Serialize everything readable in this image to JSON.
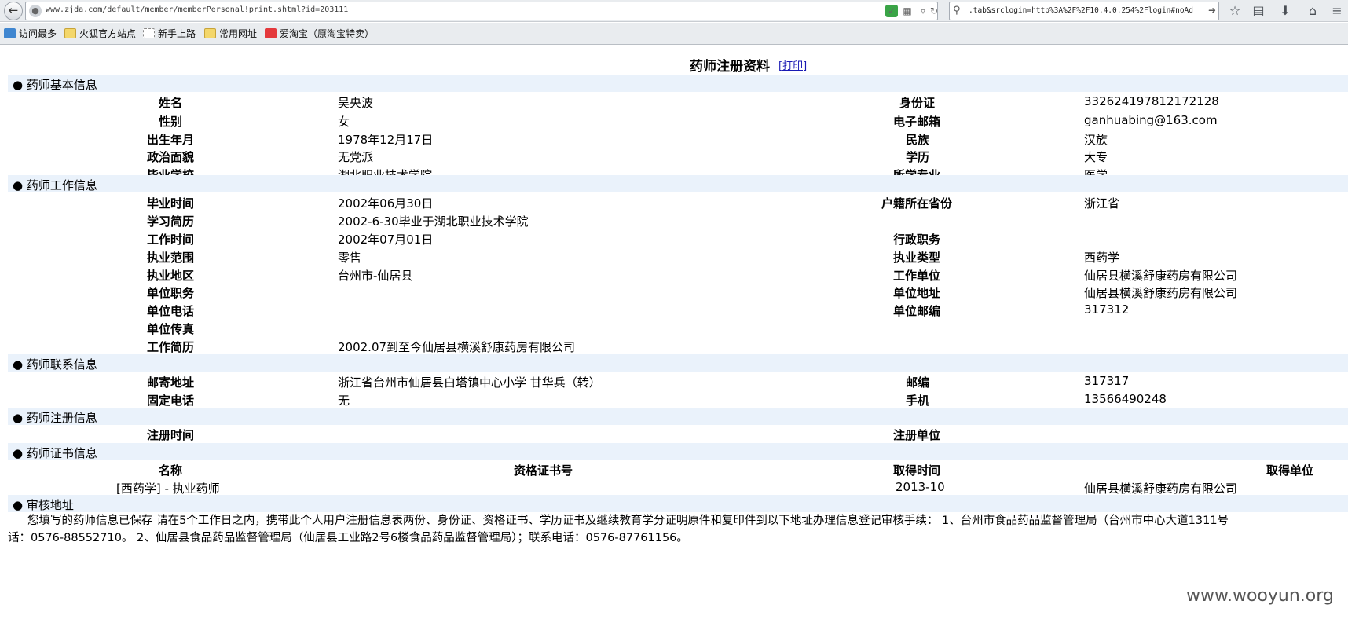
{
  "browser": {
    "url": "www.zjda.com/default/member/memberPersonal!print.shtml?id=203111",
    "search": ".tab&srclogin=http%3A%2F%2F10.4.0.254%2Flogin#noAd",
    "bookmarks": [
      "访问最多",
      "火狐官方站点",
      "新手上路",
      "常用网址",
      "爱淘宝（原淘宝特卖）"
    ]
  },
  "page": {
    "title": "药师注册资料",
    "print": "[打印]"
  },
  "sections": {
    "basic": "● 药师基本信息",
    "work": "● 药师工作信息",
    "contact": "● 药师联系信息",
    "register": "● 药师注册信息",
    "cert": "● 药师证书信息",
    "audit": "● 审核地址"
  },
  "basic": {
    "name_label": "姓名",
    "name": "吴央波",
    "id_label": "身份证",
    "id": "332624197812172128",
    "gender_label": "性别",
    "gender": "女",
    "email_label": "电子邮箱",
    "email": "ganhuabing@163.com",
    "birth_label": "出生年月",
    "birth": "1978年12月17日",
    "ethnic_label": "民族",
    "ethnic": "汉族",
    "politics_label": "政治面貌",
    "politics": "无党派",
    "edu_label": "学历",
    "edu": "大专",
    "school_label": "毕业学校",
    "school": "湖北职业技术学院",
    "major_label": "所学专业",
    "major": "医学"
  },
  "work": {
    "grad_label": "毕业时间",
    "grad": "2002年06月30日",
    "province_label": "户籍所在省份",
    "province": "浙江省",
    "study_label": "学习简历",
    "study": "2002-6-30毕业于湖北职业技术学院",
    "start_label": "工作时间",
    "start": "2002年07月01日",
    "admin_label": "行政职务",
    "admin": "",
    "scope_label": "执业范围",
    "scope": "零售",
    "type_label": "执业类型",
    "type": "西药学",
    "area_label": "执业地区",
    "area": "台州市-仙居县",
    "unit_label": "工作单位",
    "unit": "仙居县横溪舒康药房有限公司",
    "duty_label": "单位职务",
    "duty": "",
    "addr_label": "单位地址",
    "addr": "仙居县横溪舒康药房有限公司",
    "tel_label": "单位电话",
    "tel": "",
    "zip_label": "单位邮编",
    "zip": "317312",
    "fax_label": "单位传真",
    "fax": "",
    "resume_label": "工作简历",
    "resume": "2002.07到至今仙居县横溪舒康药房有限公司"
  },
  "contact": {
    "mail_label": "邮寄地址",
    "mail": "浙江省台州市仙居县白塔镇中心小学 甘华兵（转）",
    "postcode_label": "邮编",
    "postcode": "317317",
    "phone_label": "固定电话",
    "phone": "无",
    "mobile_label": "手机",
    "mobile": "13566490248"
  },
  "register": {
    "time_label": "注册时间",
    "unit_label": "注册单位"
  },
  "cert": {
    "headers": [
      "名称",
      "资格证书号",
      "取得时间",
      "取得单位"
    ],
    "row": [
      "[西药学] - 执业药师",
      "",
      "2013-10",
      "仙居县横溪舒康药房有限公司"
    ]
  },
  "notice": {
    "line1": "您填写的药师信息已保存 请在5个工作日之内，携带此个人用户注册信息表两份、身份证、资格证书、学历证书及继续教育学分证明原件和复印件到以下地址办理信息登记审核手续： 1、台州市食品药品监督管理局（台州市中心大道1311号",
    "line2": "话：0576-88552710。 2、仙居县食品药品监督管理局（仙居县工业路2号6楼食品药品监督管理局）；联系电话：0576-87761156。"
  },
  "watermark": "www.wooyun.org"
}
